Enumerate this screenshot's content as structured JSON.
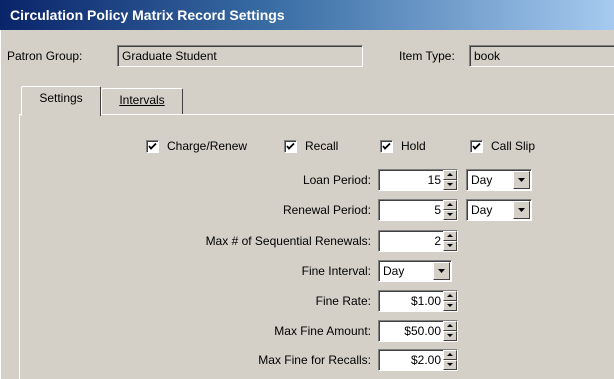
{
  "window": {
    "title": "Circulation Policy Matrix Record Settings"
  },
  "header": {
    "patron_group_label": "Patron Group:",
    "patron_group_value": "Graduate Student",
    "item_type_label": "Item Type:",
    "item_type_value": "book"
  },
  "tabs": [
    {
      "label": "Settings",
      "active": true
    },
    {
      "label": "Intervals",
      "active": false
    }
  ],
  "checkboxes": [
    {
      "label": "Charge/Renew",
      "checked": true
    },
    {
      "label": "Recall",
      "checked": true
    },
    {
      "label": "Hold",
      "checked": true
    },
    {
      "label": "Call Slip",
      "checked": true
    }
  ],
  "settings": {
    "loan_period": {
      "label": "Loan Period:",
      "value": "15",
      "unit": "Day"
    },
    "renewal_period": {
      "label": "Renewal Period:",
      "value": "5",
      "unit": "Day"
    },
    "max_renewals": {
      "label": "Max # of Sequential Renewals:",
      "value": "2"
    },
    "fine_interval": {
      "label": "Fine Interval:",
      "value": "Day"
    },
    "fine_rate": {
      "label": "Fine Rate:",
      "value": "$1.00"
    },
    "max_fine": {
      "label": "Max Fine Amount:",
      "value": "$50.00"
    },
    "max_fine_recalls": {
      "label": "Max Fine for Recalls:",
      "value": "$2.00"
    }
  },
  "icons": {
    "checkmark": "checkmark-icon",
    "spin_up": "spin-up-arrow-icon",
    "spin_down": "spin-down-arrow-icon",
    "dropdown": "chevron-down-icon"
  }
}
